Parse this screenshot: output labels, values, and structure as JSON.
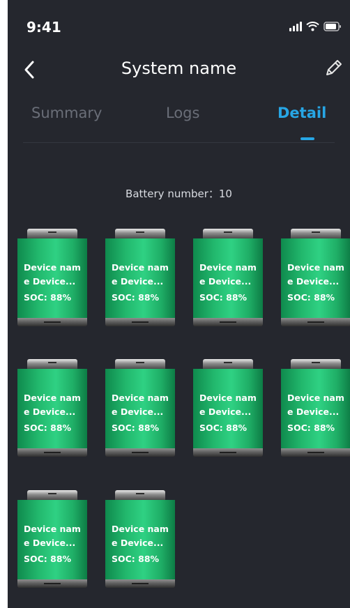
{
  "status_bar": {
    "time": "9:41",
    "icons": [
      "signal-icon",
      "wifi-icon",
      "battery-icon"
    ]
  },
  "header": {
    "title": "System name",
    "back_icon": "chevron-left-icon",
    "edit_icon": "pencil-icon"
  },
  "tabs": [
    {
      "label": "Summary",
      "active": false
    },
    {
      "label": "Logs",
      "active": false
    },
    {
      "label": "Detail",
      "active": true
    }
  ],
  "colors": {
    "background": "#25272e",
    "accent": "#27a6e5",
    "battery_green": "#22b86d"
  },
  "battery_count_label": "Battery number：10",
  "batteries": [
    {
      "name": "Device name Device...",
      "soc": "SOC: 88%"
    },
    {
      "name": "Device name Device...",
      "soc": "SOC: 88%"
    },
    {
      "name": "Device name Device...",
      "soc": "SOC: 88%"
    },
    {
      "name": "Device name Device...",
      "soc": "SOC: 88%"
    },
    {
      "name": "Device name Device...",
      "soc": "SOC: 88%"
    },
    {
      "name": "Device name Device...",
      "soc": "SOC: 88%"
    },
    {
      "name": "Device name Device...",
      "soc": "SOC: 88%"
    },
    {
      "name": "Device name Device...",
      "soc": "SOC: 88%"
    },
    {
      "name": "Device name Device...",
      "soc": "SOC: 88%"
    },
    {
      "name": "Device name Device...",
      "soc": "SOC: 88%"
    }
  ]
}
